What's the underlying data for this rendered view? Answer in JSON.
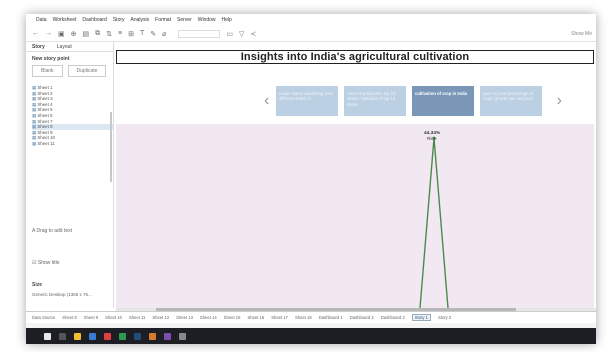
{
  "menu": [
    "Data",
    "Worksheet",
    "Dashboard",
    "Story",
    "Analysis",
    "Format",
    "Server",
    "Window",
    "Help"
  ],
  "toolbar": {
    "show_me": "Show Me"
  },
  "sidebar": {
    "tab_story": "Story",
    "tab_layout": "Layout",
    "new_story_point": "New story point",
    "blank": "Blank",
    "duplicate": "Duplicate",
    "sheets": [
      "Sheet 1",
      "Sheet 2",
      "Sheet 3",
      "Sheet 4",
      "Sheet 5",
      "Sheet 6",
      "Sheet 7",
      "Sheet 8",
      "Sheet 9",
      "Sheet 10",
      "Sheet 11"
    ],
    "selected_sheet": 7,
    "drag_text": "Drag to add text",
    "show_title": "Show title",
    "size_label": "Size",
    "size_value": "Generic Desktop (1366 x 76..."
  },
  "story": {
    "title": "Insights into India's agricultural cultivation",
    "points": [
      "Indian states visualizing area different states in",
      "Area Vs production top 10 states / statistics of top 10 states",
      "cultivation of crop in India",
      "year on year percentage of major growth rate and year"
    ],
    "active_point": 2
  },
  "chart_data": {
    "type": "line",
    "points": [
      {
        "label": "Rice",
        "value_label": "44.34%"
      }
    ],
    "color": "#4a8a4a"
  },
  "tabs": [
    "Data Source",
    "Sheet 8",
    "Sheet 9",
    "Sheet 10",
    "Sheet 11",
    "Sheet 12",
    "Sheet 13",
    "Sheet 14",
    "Sheet 15",
    "Sheet 16",
    "Sheet 17",
    "Sheet 18",
    "Dashboard 1",
    "Dashboard 2",
    "Dashboard 3",
    "Story 1",
    "Story 2"
  ],
  "active_tab": 15,
  "colors": {
    "accent": "#7a97b8",
    "viz_bg": "#f2e8f2",
    "line": "#4a8a4a"
  }
}
